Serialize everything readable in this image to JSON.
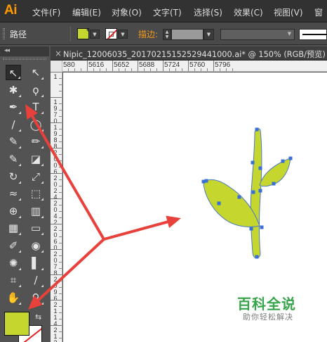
{
  "app": {
    "logo": "Ai"
  },
  "menu": {
    "items": [
      "文件(F)",
      "编辑(E)",
      "对象(O)",
      "文字(T)",
      "选择(S)",
      "效果(C)",
      "视图(V)",
      "窗"
    ]
  },
  "control_bar": {
    "object_type": "路径",
    "stroke_label": "描边:",
    "colors": {
      "fill": "#c5d62e",
      "stroke_none_slash": "#e32222",
      "stroke_label": "#f29b1d"
    }
  },
  "toolbox": {
    "collapse_glyph": "◂◂",
    "tools": [
      {
        "name": "selection-tool-icon",
        "glyph": "↖",
        "active": true
      },
      {
        "name": "direct-selection-tool-icon",
        "glyph": "↖"
      },
      {
        "name": "magic-wand-tool-icon",
        "glyph": "✱"
      },
      {
        "name": "lasso-tool-icon",
        "glyph": "ϙ"
      },
      {
        "name": "pen-tool-icon",
        "glyph": "✒"
      },
      {
        "name": "type-tool-icon",
        "glyph": "T"
      },
      {
        "name": "line-segment-tool-icon",
        "glyph": "/"
      },
      {
        "name": "ellipse-tool-icon",
        "glyph": "◯"
      },
      {
        "name": "paintbrush-tool-icon",
        "glyph": "✎"
      },
      {
        "name": "pencil-tool-icon",
        "glyph": "✏"
      },
      {
        "name": "blob-brush-tool-icon",
        "glyph": "✎"
      },
      {
        "name": "eraser-tool-icon",
        "glyph": "◪"
      },
      {
        "name": "rotate-tool-icon",
        "glyph": "↻"
      },
      {
        "name": "scale-tool-icon",
        "glyph": "⤢"
      },
      {
        "name": "width-tool-icon",
        "glyph": "≈"
      },
      {
        "name": "free-transform-tool-icon",
        "glyph": "⬚"
      },
      {
        "name": "shape-builder-tool-icon",
        "glyph": "⊕"
      },
      {
        "name": "perspective-grid-tool-icon",
        "glyph": "▥"
      },
      {
        "name": "mesh-tool-icon",
        "glyph": "▦"
      },
      {
        "name": "gradient-tool-icon",
        "glyph": "▭"
      },
      {
        "name": "eyedropper-tool-icon",
        "glyph": "✐"
      },
      {
        "name": "blend-tool-icon",
        "glyph": "◉"
      },
      {
        "name": "symbol-sprayer-tool-icon",
        "glyph": "✺"
      },
      {
        "name": "column-graph-tool-icon",
        "glyph": "▌"
      },
      {
        "name": "artboard-tool-icon",
        "glyph": "⌗"
      },
      {
        "name": "slice-tool-icon",
        "glyph": "∕"
      },
      {
        "name": "hand-tool-icon",
        "glyph": "✋"
      },
      {
        "name": "zoom-tool-icon",
        "glyph": "⚲"
      }
    ],
    "swap_glyph": "⇆"
  },
  "document": {
    "close_glyph": "×",
    "title": "Nipic_12006035_20170215152529441000.ai*  @  150%  (RGB/预览)"
  },
  "rulers": {
    "top_labels": [
      "580",
      "5616",
      "5652",
      "5688",
      "5724",
      "5760",
      "5796"
    ],
    "left_labels": [
      "1",
      "1 9 7 0",
      "1 9 8 8",
      "2 0 0 6",
      "2 0 2 4",
      "2 0 4 2",
      "2 0 6 0",
      "2 0 7 8",
      "2 0 9 6",
      "2 1 1 4",
      "2 1 3 2"
    ]
  },
  "artwork": {
    "leaf_fill": "#c5d62e",
    "leaf_stroke": "#4a78c8",
    "anchor_color": "#3a6fd6"
  },
  "watermark": {
    "title": "百科全说",
    "subtitle": "助你轻松解决"
  },
  "annotations": {
    "arrow_color": "#e8403a"
  }
}
